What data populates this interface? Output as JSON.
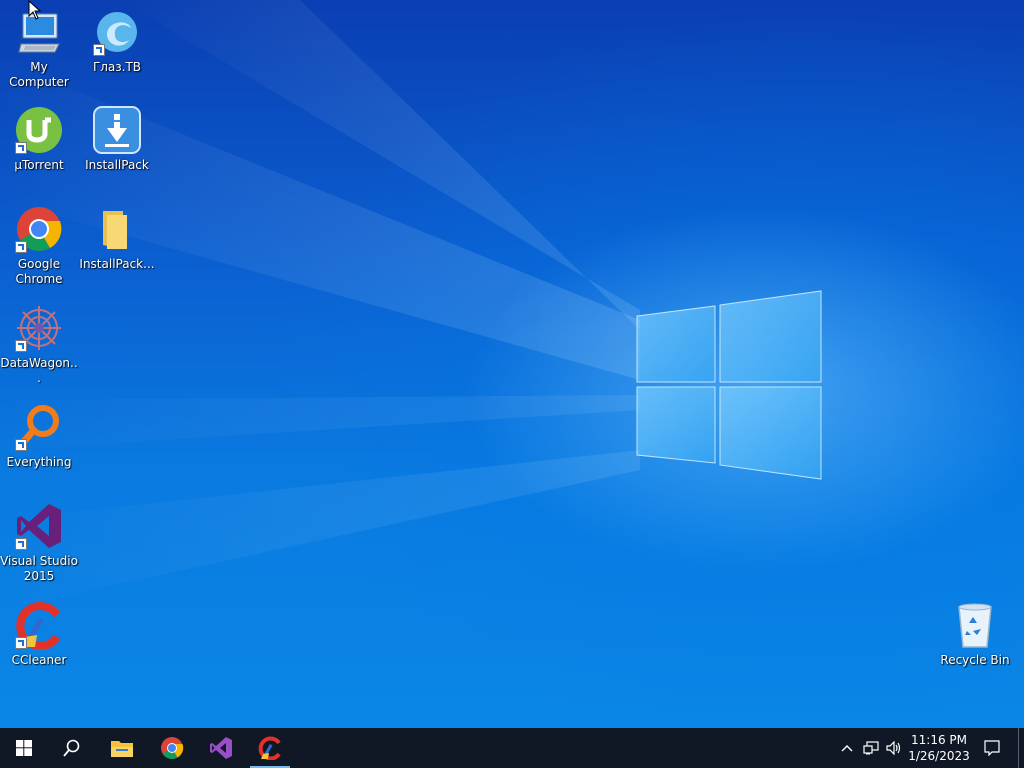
{
  "desktop": {
    "icons": [
      {
        "label": "My Computer",
        "icon": "computer-icon",
        "shortcut": false
      },
      {
        "label": "Глаз.ТВ",
        "icon": "glaz-tv-icon",
        "shortcut": true
      },
      {
        "label": "µTorrent",
        "icon": "utorrent-icon",
        "shortcut": true
      },
      {
        "label": "InstallPack",
        "icon": "installpack-icon",
        "shortcut": false
      },
      {
        "label": "Google Chrome",
        "icon": "chrome-icon",
        "shortcut": true
      },
      {
        "label": "InstallPack...",
        "icon": "folder-icon",
        "shortcut": false
      },
      {
        "label": "DataWagon...",
        "icon": "datawagon-icon",
        "shortcut": true
      },
      {
        "label": "Everything",
        "icon": "everything-search-icon",
        "shortcut": true
      },
      {
        "label": "Visual Studio 2015",
        "icon": "visual-studio-icon",
        "shortcut": true
      },
      {
        "label": "CCleaner",
        "icon": "ccleaner-icon",
        "shortcut": true
      },
      {
        "label": "Recycle Bin",
        "icon": "recycle-bin-icon",
        "shortcut": false
      }
    ]
  },
  "taskbar": {
    "pinned": [
      {
        "name": "start",
        "icon": "windows-start-icon"
      },
      {
        "name": "search",
        "icon": "search-icon"
      },
      {
        "name": "file-explorer",
        "icon": "folder-icon"
      },
      {
        "name": "chrome",
        "icon": "chrome-icon"
      },
      {
        "name": "visual-studio",
        "icon": "visual-studio-icon"
      },
      {
        "name": "ccleaner",
        "icon": "ccleaner-icon",
        "active": true
      }
    ],
    "tray": {
      "icons": [
        "chevron-up-icon",
        "network-icon",
        "volume-icon"
      ],
      "time": "11:16 PM",
      "date": "1/26/2023",
      "notification_icon": "action-center-icon"
    }
  },
  "colors": {
    "taskbar": "#101826",
    "accent": "#76b9ed",
    "wallpaper_blue": "#0a6fdc"
  }
}
